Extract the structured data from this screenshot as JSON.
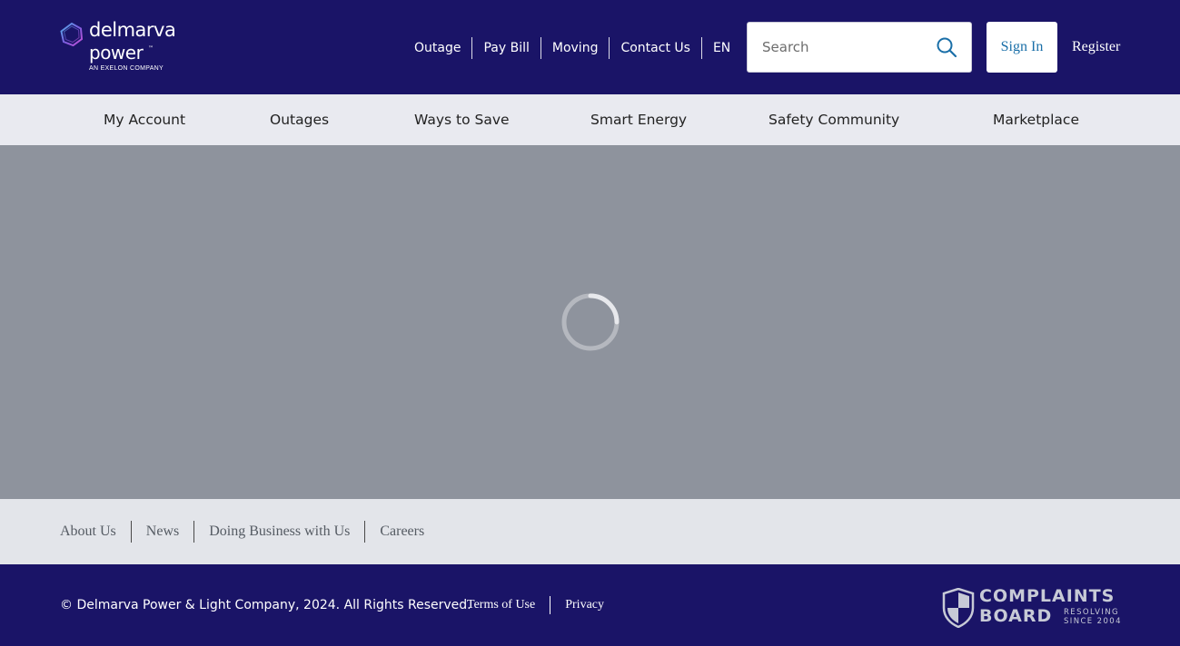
{
  "brand": {
    "name_line1": "delmarva",
    "name_line2": "power",
    "trademark": "™",
    "parent": "AN EXELON COMPANY"
  },
  "utility_nav": {
    "items": [
      {
        "label": "Outage"
      },
      {
        "label": "Pay Bill"
      },
      {
        "label": "Moving"
      },
      {
        "label": "Contact Us"
      },
      {
        "label": "EN"
      }
    ]
  },
  "search": {
    "placeholder": "Search",
    "icon": "search-icon"
  },
  "auth": {
    "signin_label": "Sign In",
    "register_label": "Register"
  },
  "main_nav": {
    "items": [
      {
        "label": "My Account"
      },
      {
        "label": "Outages"
      },
      {
        "label": "Ways to Save"
      },
      {
        "label": "Smart Energy"
      },
      {
        "label": "Safety  Community"
      },
      {
        "label": "Marketplace"
      }
    ]
  },
  "loading": {
    "icon": "loading-spinner-icon"
  },
  "footer": {
    "links": [
      {
        "label": "About Us"
      },
      {
        "label": "News"
      },
      {
        "label": "Doing Business with Us"
      },
      {
        "label": "Careers"
      }
    ],
    "copyright": "© Delmarva Power & Light Company, 2024. All Rights Reserved.",
    "legal_links": [
      {
        "label": "Terms of Use"
      },
      {
        "label": "Privacy"
      }
    ]
  },
  "complaints_board": {
    "line1": "COMPLAINTS",
    "line2": "BOARD",
    "tagline1": "RESOLVING",
    "tagline2": "SINCE 2004"
  },
  "colors": {
    "header_bg": "#1a1467",
    "nav_bg": "#e9eaf0",
    "overlay_bg": "#8e939d",
    "footer_links_bg": "#e3e5ea",
    "signin_text": "#1a6fa8"
  }
}
